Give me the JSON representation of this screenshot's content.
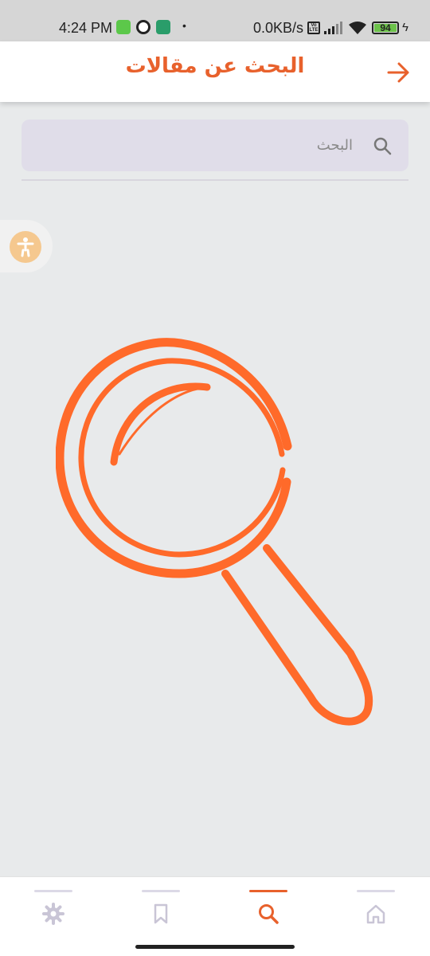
{
  "status_bar": {
    "time": "4:24 PM",
    "network_speed": "0.0KB/s",
    "volte": "Vo LTE",
    "battery_level": "94",
    "icons": [
      "app-notification-icon",
      "signal-icon",
      "wifi-icon",
      "battery-icon",
      "charging-icon"
    ]
  },
  "header": {
    "title": "البحث عن مقالات",
    "back_icon": "arrow-right-icon"
  },
  "search": {
    "placeholder": "البحث",
    "value": "",
    "icon": "search-icon"
  },
  "accessibility_button": {
    "icon": "accessibility-icon"
  },
  "illustration": {
    "icon": "magnifying-glass-illustration"
  },
  "bottom_nav": {
    "items": [
      {
        "id": "settings",
        "icon": "gear-icon",
        "active": false
      },
      {
        "id": "bookmarks",
        "icon": "bookmark-icon",
        "active": false
      },
      {
        "id": "search",
        "icon": "search-icon",
        "active": true
      },
      {
        "id": "home",
        "icon": "home-icon",
        "active": false
      }
    ]
  },
  "colors": {
    "accent": "#e8612c",
    "illustration": "#ff6a2a",
    "background": "#e8eaeb",
    "search_bg": "#e0dde9",
    "inactive_icon": "#c9c5d6"
  }
}
